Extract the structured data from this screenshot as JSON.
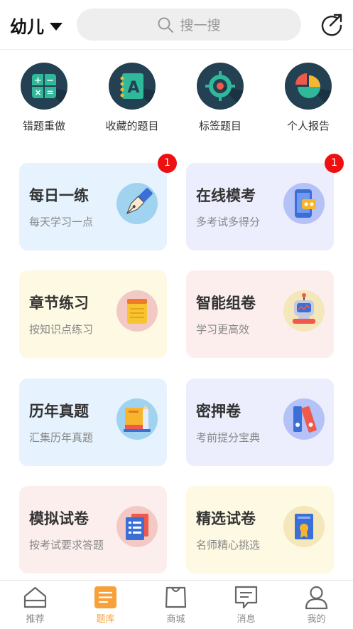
{
  "header": {
    "grade_label": "幼儿",
    "search_placeholder": "搜一搜"
  },
  "quick_actions": [
    {
      "label": "错题重做",
      "icon": "calculator-icon"
    },
    {
      "label": "收藏的题目",
      "icon": "notebook-a-icon"
    },
    {
      "label": "标签题目",
      "icon": "target-icon"
    },
    {
      "label": "个人报告",
      "icon": "pie-chart-icon"
    }
  ],
  "cards": [
    {
      "title": "每日一练",
      "subtitle": "每天学习一点",
      "badge": "1",
      "icon": "pen-icon"
    },
    {
      "title": "在线模考",
      "subtitle": "多考试多得分",
      "badge": "1",
      "icon": "phone-exam-icon"
    },
    {
      "title": "章节练习",
      "subtitle": "按知识点练习",
      "icon": "notepad-icon"
    },
    {
      "title": "智能组卷",
      "subtitle": "学习更高效",
      "icon": "robot-icon"
    },
    {
      "title": "历年真题",
      "subtitle": "汇集历年真题",
      "icon": "books-icon"
    },
    {
      "title": "密押卷",
      "subtitle": "考前提分宝典",
      "icon": "binders-icon"
    },
    {
      "title": "模拟试卷",
      "subtitle": "按考试要求答题",
      "icon": "papers-icon"
    },
    {
      "title": "精选试卷",
      "subtitle": "名师精心挑选",
      "icon": "certificate-icon"
    }
  ],
  "tabbar": [
    {
      "label": "推荐",
      "icon": "home-icon",
      "active": false
    },
    {
      "label": "题库",
      "icon": "list-icon",
      "active": true
    },
    {
      "label": "商城",
      "icon": "bag-icon",
      "active": false
    },
    {
      "label": "消息",
      "icon": "message-icon",
      "active": false
    },
    {
      "label": "我的",
      "icon": "user-icon",
      "active": false
    }
  ],
  "colors": {
    "accent": "#f7a13a",
    "badge": "#ee1010",
    "icon_dark": "#234152",
    "card_blue": "#e6f2fd",
    "card_purple": "#eceefd",
    "card_yellow": "#fdf9e3",
    "card_pink": "#fdeeee"
  }
}
